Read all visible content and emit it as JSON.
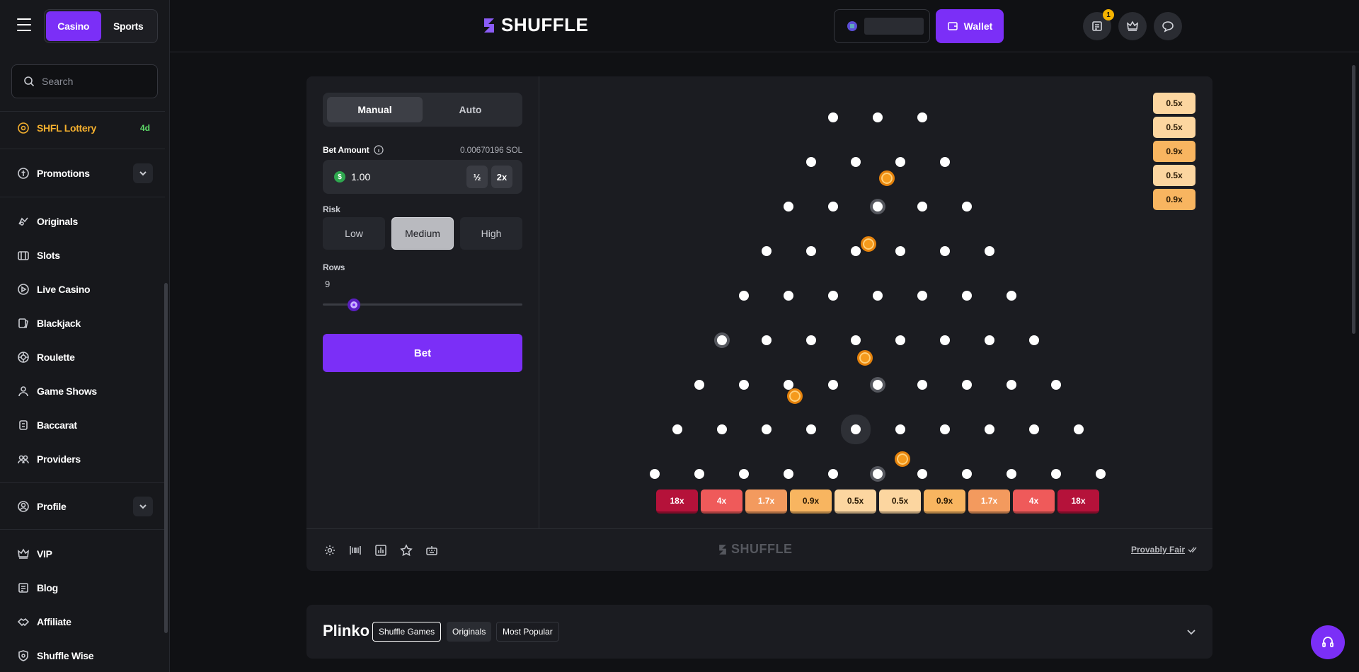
{
  "nav": {
    "casino": "Casino",
    "sports": "Sports"
  },
  "sidebar": {
    "search_placeholder": "Search",
    "lottery": {
      "label": "SHFL Lottery",
      "badge": "4d"
    },
    "promotions": "Promotions",
    "items": [
      "Originals",
      "Slots",
      "Live Casino",
      "Blackjack",
      "Roulette",
      "Game Shows",
      "Baccarat",
      "Providers"
    ],
    "profile": "Profile",
    "bottom": [
      "VIP",
      "Blog",
      "Affiliate",
      "Shuffle Wise"
    ]
  },
  "header": {
    "logo": "SHUFFLE",
    "wallet": "Wallet",
    "notif_count": "1"
  },
  "game": {
    "tabs": {
      "manual": "Manual",
      "auto": "Auto"
    },
    "bet_label": "Bet Amount",
    "bet_conv": "0.00670196 SOL",
    "bet_value": "1.00",
    "currency_symbol": "$",
    "half": "½",
    "double": "2x",
    "risk_label": "Risk",
    "risk": [
      "Low",
      "Medium",
      "High"
    ],
    "risk_selected": "Medium",
    "rows_label": "Rows",
    "rows_value": "9",
    "bet_button": "Bet",
    "multipliers": [
      "18",
      "4",
      "1.7",
      "0.9",
      "0.5",
      "0.5",
      "0.9",
      "1.7",
      "4",
      "18"
    ],
    "history": [
      "0.5",
      "0.5",
      "0.9",
      "0.5",
      "0.9"
    ],
    "mult_suffix": "x",
    "footer_logo": "SHUFFLE",
    "provably_fair": "Provably Fair"
  },
  "colors": {
    "accent": "#7b2ff7",
    "slot": [
      "#b5123a",
      "#ef5a5a",
      "#f39a5e",
      "#f8b560",
      "#fcd6a0",
      "#fcd6a0",
      "#f8b560",
      "#f39a5e",
      "#ef5a5a",
      "#b5123a"
    ],
    "history": [
      "#fcd6a0",
      "#fcd6a0",
      "#f8b560",
      "#fcd6a0",
      "#f8b560"
    ]
  },
  "info": {
    "title": "Plinko",
    "tags": [
      "Shuffle Games",
      "Originals",
      "Most Popular"
    ]
  }
}
